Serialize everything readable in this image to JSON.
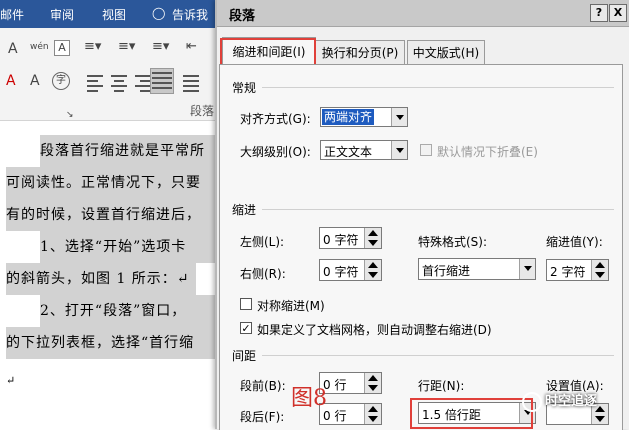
{
  "ribbon": {
    "tabs": [
      "邮件",
      "审阅",
      "视图"
    ],
    "tell_me": "告诉我",
    "group_label": "段落",
    "font_buttons": [
      "A",
      "wén",
      "A",
      "A",
      "A",
      "字"
    ]
  },
  "document": {
    "lines": [
      "段落首行缩进就是平常所",
      "可阅读性。正常情况下，只要",
      "有的时候，设置首行缩进后，",
      "1、选择“开始”选项卡",
      "的斜箭头，如图 1 所示：↵",
      "2、打开“段落”窗口，",
      "的下拉列表框，选择“首行缩",
      "↵"
    ]
  },
  "dialog": {
    "title": "段落",
    "help_button": "?",
    "close_button": "X",
    "tabs": [
      {
        "label": "缩进和间距(I)"
      },
      {
        "label": "换行和分页(P)"
      },
      {
        "label": "中文版式(H)"
      }
    ],
    "general": {
      "heading": "常规",
      "alignment_label": "对齐方式(G):",
      "alignment_value": "两端对齐",
      "outline_label": "大纲级别(O):",
      "outline_value": "正文文本",
      "collapse_label": "默认情况下折叠(E)"
    },
    "indent": {
      "heading": "缩进",
      "left_label": "左侧(L):",
      "left_value": "0 字符",
      "right_label": "右侧(R):",
      "right_value": "0 字符",
      "special_label": "特殊格式(S):",
      "special_value": "首行缩进",
      "by_label": "缩进值(Y):",
      "by_value": "2 字符",
      "mirror_label": "对称缩进(M)",
      "mirror_checked": false,
      "grid_label": "如果定义了文档网格，则自动调整右缩进(D)",
      "grid_checked": true
    },
    "spacing": {
      "heading": "间距",
      "before_label": "段前(B):",
      "before_value": "0 行",
      "after_label": "段后(F):",
      "after_value": "0 行",
      "line_label": "行距(N):",
      "line_value": "1.5 倍行距",
      "at_label": "设置值(A):"
    }
  },
  "annotations": {
    "figure_label": "图8",
    "watermark": "时空追逐"
  },
  "colors": {
    "ribbon_blue": "#2b579a",
    "highlight_red": "#e0403a",
    "selection_blue": "#1e5bbf",
    "text_highlight_gray": "#d2d2d2"
  }
}
